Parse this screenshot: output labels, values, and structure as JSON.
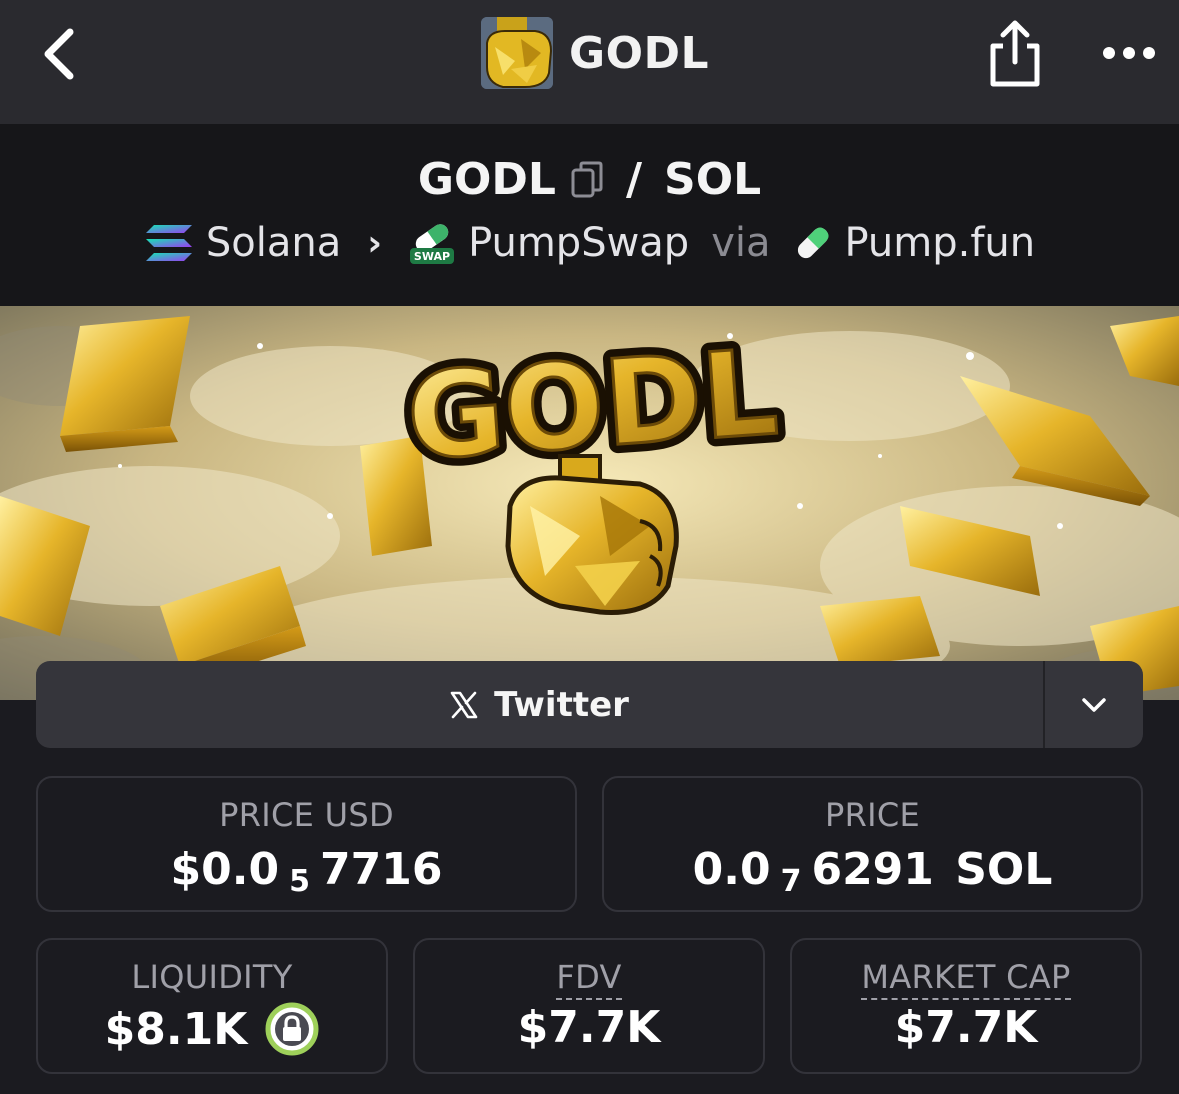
{
  "nav": {
    "title": "GODL",
    "back_icon": "chevron-left-icon",
    "share_icon": "share-icon",
    "more_icon": "more-dots-icon"
  },
  "pair": {
    "base": "GODL",
    "separator": "/",
    "quote": "SOL",
    "chain": "Solana",
    "dex": "PumpSwap",
    "via": "via",
    "launchpad": "Pump.fun"
  },
  "banner": {
    "logo_text": "GODL"
  },
  "social": {
    "twitter_label": "Twitter",
    "twitter_icon": "x-logo-icon"
  },
  "stats": {
    "price_usd": {
      "label": "PRICE USD",
      "prefix": "$0.0",
      "zeros": "5",
      "digits": "7716",
      "suffix": ""
    },
    "price_native": {
      "label": "PRICE",
      "prefix": "0.0",
      "zeros": "7",
      "digits": "6291",
      "suffix": " SOL"
    },
    "liquidity": {
      "label": "LIQUIDITY",
      "value": "$8.1K"
    },
    "fdv": {
      "label": "FDV",
      "value": "$7.7K"
    },
    "market_cap": {
      "label": "MARKET CAP",
      "value": "$7.7K"
    }
  },
  "colors": {
    "background": "#1b1b20",
    "topbar": "#2a2a2f",
    "pair_header": "#161619",
    "lock_ring": "#9ed05a"
  }
}
